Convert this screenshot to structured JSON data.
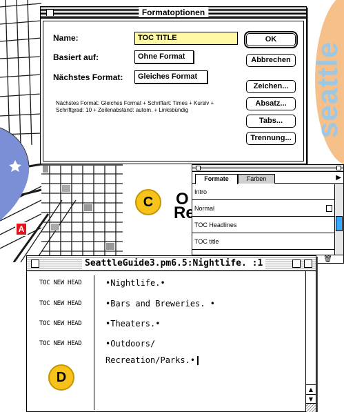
{
  "dialog": {
    "title": "Formatoptionen",
    "name_label": "Name:",
    "name_value": "TOC TITLE",
    "based_on_label": "Basiert auf:",
    "based_on_value": "Ohne Format",
    "next_style_label": "Nächstes Format:",
    "next_style_value": "Gleiches Format",
    "summary": "Nächstes Format: Gleiches Format + Schriftart: Times + Kursiv + Schriftgrad: 10 + Zeilenabstand: autom. + Linksbündig",
    "buttons": {
      "ok": "OK",
      "cancel": "Abbrechen",
      "char": "Zeichen...",
      "para": "Absatz...",
      "tabs": "Tabs...",
      "hyphen": "Trennung..."
    },
    "colors": {
      "name_field_bg": "#fff9a6"
    }
  },
  "overlay": {
    "seattle_word": "seattle",
    "callout_c": "C",
    "callout_d": "D",
    "doc_glyph_top": "O",
    "doc_glyph_bottom": "Re",
    "map_marker": "A"
  },
  "palette": {
    "tabs": [
      "Formate",
      "Farben"
    ],
    "styles": [
      {
        "name": "Intro",
        "icon": ""
      },
      {
        "name": "Normal",
        "icon": "document-icon"
      },
      {
        "name": "TOC Headlines",
        "icon": ""
      },
      {
        "name": "TOC title",
        "icon": ""
      }
    ],
    "scroll_thumb_color": "#33aaff"
  },
  "story": {
    "title": "SeattleGuide3.pm6.5:Nightlife. :1",
    "style_items": [
      "TOC NEW HEAD",
      "TOC NEW HEAD",
      "TOC NEW HEAD",
      "TOC NEW HEAD"
    ],
    "paragraphs": [
      "•Nightlife.•",
      "•Bars and Breweries. •",
      "•Theaters.•",
      "•Outdoors/",
      "Recreation/Parks.•"
    ]
  }
}
